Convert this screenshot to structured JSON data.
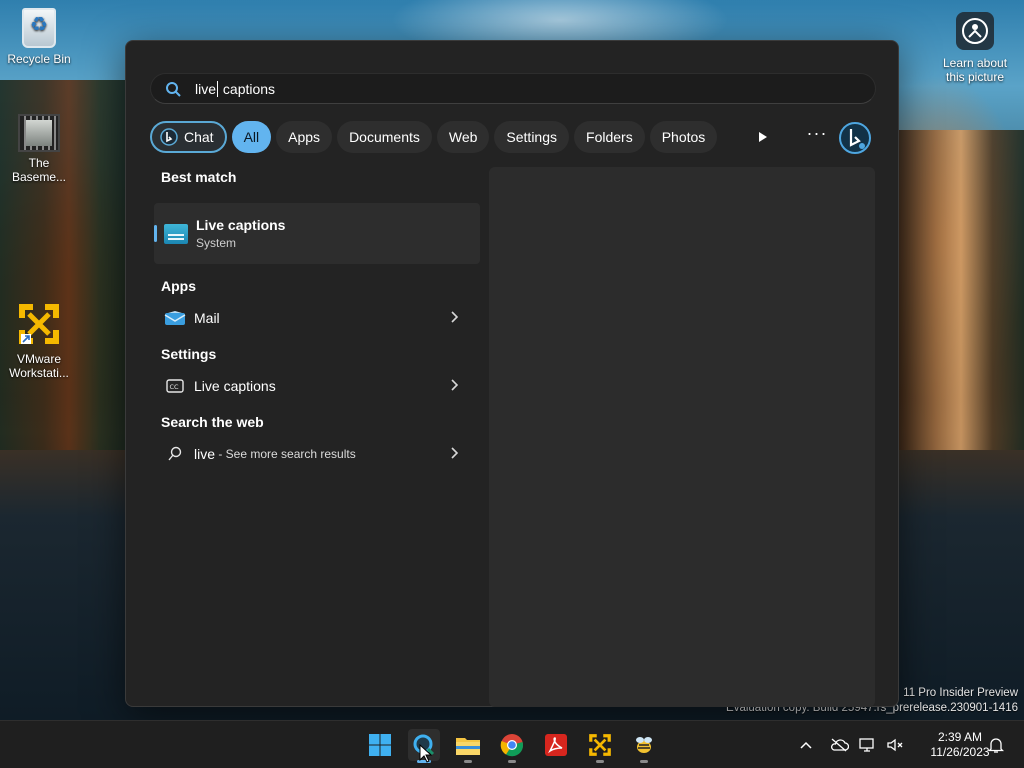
{
  "desktop": {
    "icons": [
      {
        "label": "Recycle Bin",
        "icon": "recycle-bin-icon"
      },
      {
        "label": "The Baseme...",
        "icon": "video-file-icon"
      },
      {
        "label": "VMware Workstati...",
        "icon": "vmware-icon"
      }
    ],
    "learn_label": "Learn about this picture",
    "watermark_line1": "11 Pro Insider Preview",
    "watermark_line2": "Evaluation copy. Build 25947.rs_prerelease.230901-1416"
  },
  "search": {
    "query_before_caret": "live",
    "query_after_caret": " captions"
  },
  "filters": {
    "chat": "Chat",
    "chips": [
      "All",
      "Apps",
      "Documents",
      "Web",
      "Settings",
      "Folders",
      "Photos"
    ],
    "active": "All",
    "more": "···"
  },
  "results": {
    "best_match_header": "Best match",
    "best_match": {
      "title": "Live captions",
      "subtitle": "System",
      "icon": "live-captions-app-icon"
    },
    "apps_header": "Apps",
    "apps": [
      {
        "label": "Mail",
        "icon": "mail-icon"
      }
    ],
    "settings_header": "Settings",
    "settings": [
      {
        "label": "Live captions",
        "icon": "closed-captions-icon"
      }
    ],
    "web_header": "Search the web",
    "web": {
      "query": "live",
      "suffix": " - See more search results"
    }
  },
  "taskbar": {
    "apps": [
      "windows-start-icon",
      "search-icon",
      "file-explorer-icon",
      "chrome-icon",
      "acrobat-icon",
      "vmware-icon",
      "bee-app-icon"
    ],
    "time": "2:39 AM",
    "date": "11/26/2023"
  },
  "colors": {
    "accent": "#62b4ef",
    "panel": "#232323",
    "preview": "#2c2c2c"
  }
}
